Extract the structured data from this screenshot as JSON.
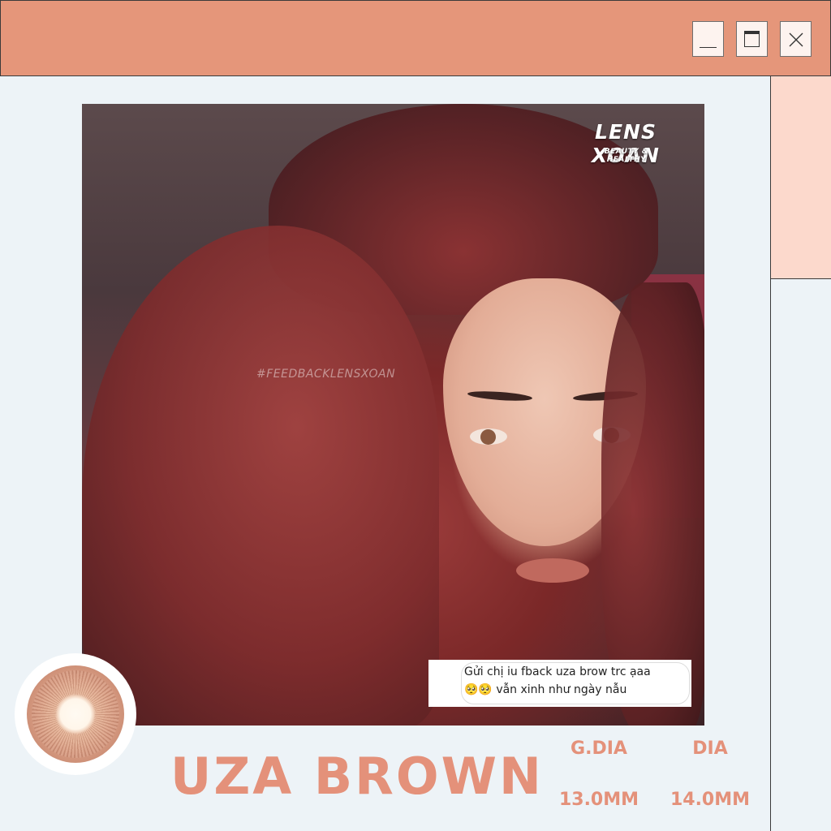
{
  "window": {
    "controls": [
      "minimize-icon",
      "maximize-icon",
      "close-icon"
    ],
    "titlebar_color": "#e5967a",
    "side_panel_color": "#fcd9cc",
    "background_color": "#edf3f7"
  },
  "photo": {
    "brand": "LENS XOAN",
    "brand_tagline": "BEAUTY & HEALTHY",
    "hashtag": "#FEEDBACKLENSXOAN",
    "comment": {
      "line1": "Gửi chị iu fback uza brow trc ạaa",
      "line2": "🥺🥺 vẫn xinh như ngày nẫu"
    }
  },
  "product": {
    "name": "UZA BROWN",
    "accent_color": "#e4917a",
    "specs": {
      "gdia_label": "G.DIA",
      "dia_label": "DIA",
      "gdia_value": "13.0MM",
      "dia_value": "14.0MM"
    }
  }
}
